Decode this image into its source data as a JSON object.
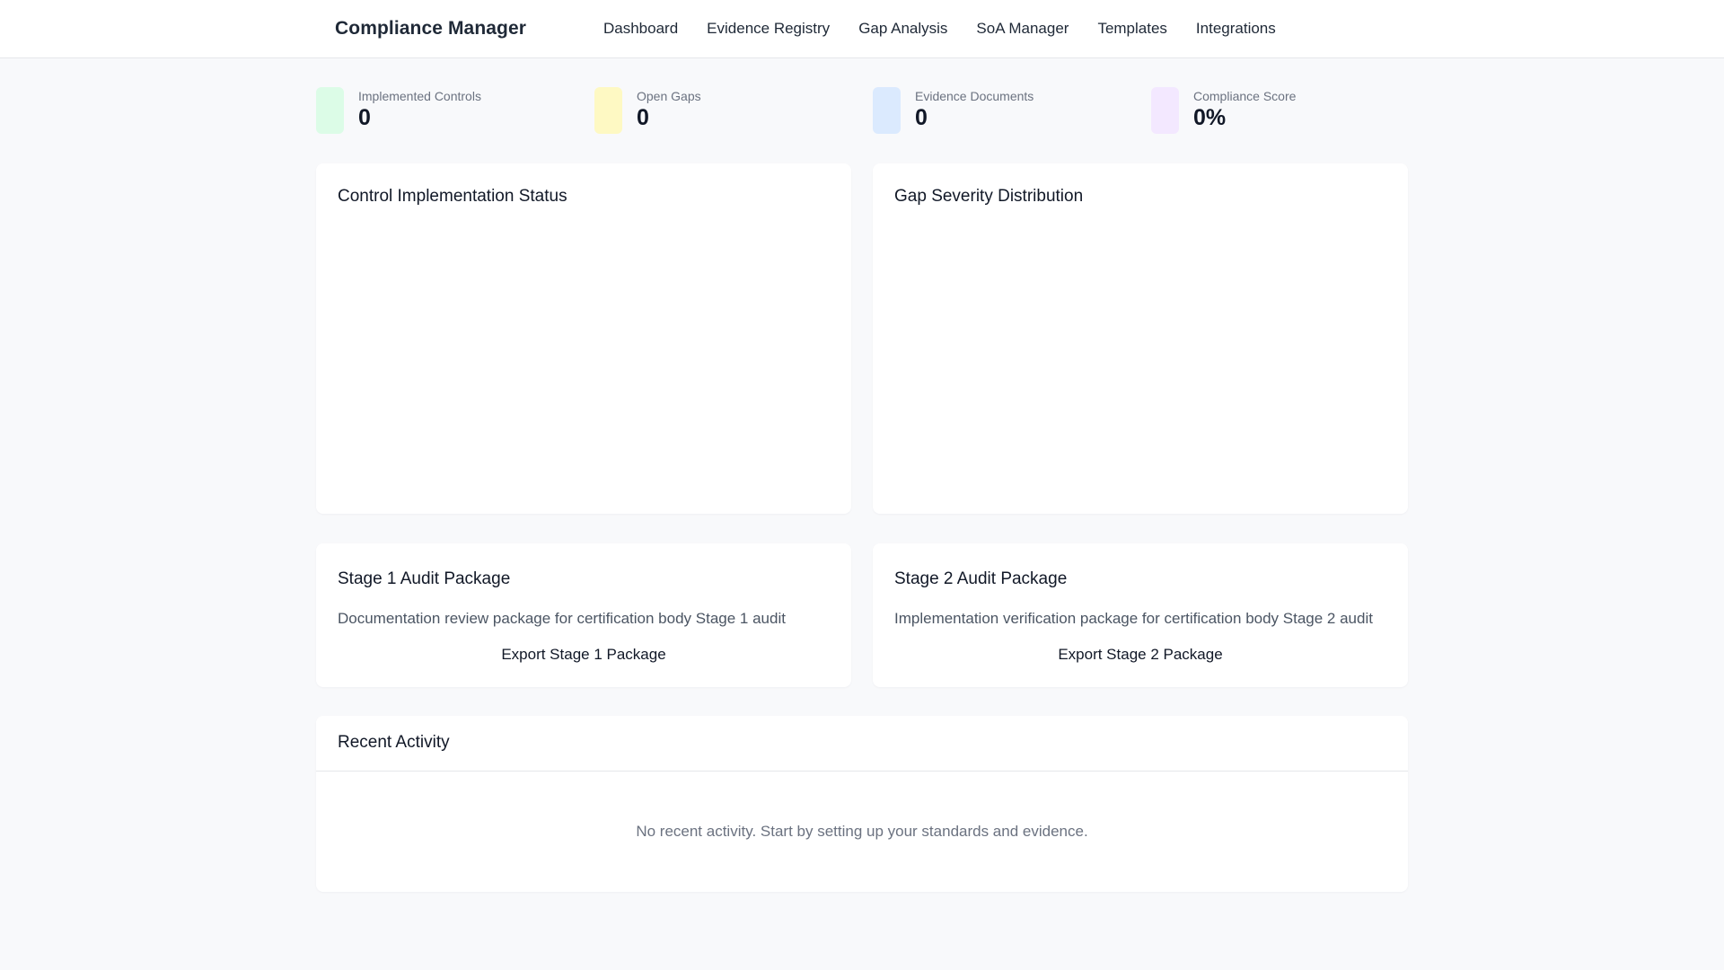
{
  "app": {
    "title": "Compliance Manager"
  },
  "nav": [
    {
      "label": "Dashboard"
    },
    {
      "label": "Evidence Registry"
    },
    {
      "label": "Gap Analysis"
    },
    {
      "label": "SoA Manager"
    },
    {
      "label": "Templates"
    },
    {
      "label": "Integrations"
    }
  ],
  "stats": [
    {
      "label": "Implemented Controls",
      "value": "0",
      "color": "#dcfce7"
    },
    {
      "label": "Open Gaps",
      "value": "0",
      "color": "#fef9c3"
    },
    {
      "label": "Evidence Documents",
      "value": "0",
      "color": "#dbeafe"
    },
    {
      "label": "Compliance Score",
      "value": "0%",
      "color": "#f3e8ff"
    }
  ],
  "charts": {
    "control_status": {
      "title": "Control Implementation Status"
    },
    "gap_severity": {
      "title": "Gap Severity Distribution"
    }
  },
  "audit": {
    "stage1": {
      "title": "Stage 1 Audit Package",
      "description": "Documentation review package for certification body Stage 1 audit",
      "button": "Export Stage 1 Package"
    },
    "stage2": {
      "title": "Stage 2 Audit Package",
      "description": "Implementation verification package for certification body Stage 2 audit",
      "button": "Export Stage 2 Package"
    }
  },
  "activity": {
    "title": "Recent Activity",
    "empty": "No recent activity. Start by setting up your standards and evidence."
  }
}
